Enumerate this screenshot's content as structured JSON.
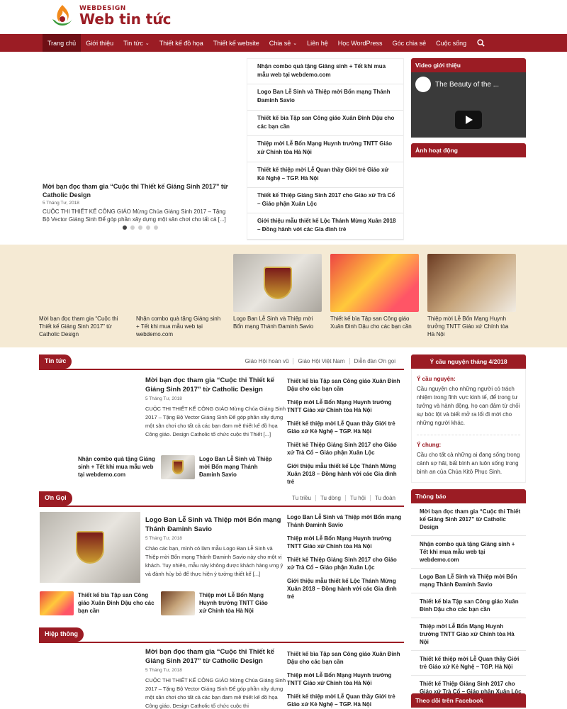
{
  "brand": {
    "sub": "WEBDESIGN",
    "main": "Web tin tức",
    "accent": "#9b1c24"
  },
  "nav": {
    "items": [
      {
        "label": "Trang chủ",
        "active": true
      },
      {
        "label": "Giới thiệu"
      },
      {
        "label": "Tin tức",
        "caret": true
      },
      {
        "label": "Thiết kế đồ họa"
      },
      {
        "label": "Thiết kế website"
      },
      {
        "label": "Chia sẻ",
        "caret": true
      },
      {
        "label": "Liên hệ"
      },
      {
        "label": "Học WordPress"
      },
      {
        "label": "Góc chia sẻ"
      },
      {
        "label": "Cuộc sống"
      }
    ],
    "search_icon": "search-icon"
  },
  "hero": {
    "title": "Mời bạn đọc tham gia “Cuộc thi Thiết kế Giáng Sinh 2017” từ Catholic Design",
    "date": "5 Tháng Tư, 2018",
    "excerpt": "CUỘC THI THIẾT KẾ CÔNG GIÁO Mừng Chúa Giáng Sinh 2017 – Tặng Bộ Vector Giáng Sinh Để góp phần xây dựng một sân chơi cho tất cả [...]",
    "slide_count": 5,
    "active_slide": 1,
    "list": [
      "Nhận combo quà tặng Giáng sinh + Tết khi mua mẫu web tại webdemo.com",
      "Logo Ban Lễ Sinh và Thiệp mời Bổn mạng Thánh Đaminh Savio",
      "Thiết kế bìa Tập san Công giáo Xuân Đinh Dậu cho các bạn cần",
      "Thiệp mời Lễ Bổn Mạng Huynh trưởng TNTT Giáo xứ Chính tòa Hà Nội",
      "Thiết kế thiệp mời Lễ Quan thầy Giới trẻ Giáo xứ Kẻ Nghệ – TGP. Hà Nội",
      "Thiết kế Thiệp Giáng Sinh 2017 cho Giáo xứ Trà Cổ – Giáo phận Xuân Lộc",
      "Giới thiệu mẫu thiết kế Lộc Thánh Mừng Xuân 2018 – Đồng hành với các Gia đình trẻ"
    ]
  },
  "sidebar": {
    "video_title": "Video giới thiệu",
    "video_caption": "The Beauty of the ...",
    "photos_title": "Ảnh hoạt động",
    "prayer_title": "Ý cầu nguyện tháng 4/2018",
    "prayer": [
      {
        "label": "Ý cầu nguyện:",
        "text": "Cầu nguyện cho những người có trách nhiệm trong lĩnh vực kinh tế, để trong tư tưởng và hành động, họ can đảm từ chối sự bóc lột và biết mở ra lối đi mới cho những người khác."
      },
      {
        "label": "Ý chung:",
        "text": "Cầu cho tất cả những ai đang sống trong cảnh sợ hãi, bất bình an luôn sống trong bình an của Chúa Kitô Phục Sinh."
      }
    ],
    "notice_title": "Thông báo",
    "notices": [
      "Mời bạn đọc tham gia “Cuộc thi Thiết kế Giáng Sinh 2017” từ Catholic Design",
      "Nhận combo quà tặng Giáng sinh + Tết khi mua mẫu web tại webdemo.com",
      "Logo Ban Lễ Sinh và Thiệp mời Bổn mạng Thánh Đaminh Savio",
      "Thiết kế bìa Tập san Công giáo Xuân Đinh Dậu cho các bạn cần",
      "Thiệp mời Lễ Bổn Mạng Huynh trưởng TNTT Giáo xứ Chính tòa Hà Nội",
      "Thiết kế thiệp mời Lễ Quan thầy Giới trẻ Giáo xứ Kẻ Nghệ – TGP. Hà Nội",
      "Thiết kế Thiệp Giáng Sinh 2017 cho Giáo xứ Trà Cổ – Giáo phận Xuân Lộc"
    ],
    "facebook_title": "Theo dõi trên Facebook"
  },
  "band": [
    "Mời bạn đọc tham gia “Cuộc thi Thiết kế Giáng Sinh 2017” từ Catholic Design",
    "Nhận combo quà tặng Giáng sinh + Tết khi mua mẫu web tại webdemo.com",
    "Logo Ban Lễ Sinh và Thiệp mời Bổn mạng Thánh Đaminh Savio",
    "Thiết kế bìa Tập san Công giáo Xuân Đinh Dậu cho các bạn cần",
    "Thiệp mời Lễ Bổn Mạng Huynh trưởng TNTT Giáo xứ Chính tòa Hà Nội"
  ],
  "sections": {
    "news": {
      "tab": "Tin tức",
      "links": [
        "Giáo Hội hoàn vũ",
        "Giáo Hội Việt Nam",
        "Diễn đàn Ơn gọi"
      ],
      "main_title": "Mời bạn đọc tham gia “Cuộc thi Thiết kế Giáng Sinh 2017” từ Catholic Design",
      "main_date": "5 Tháng Tư, 2018",
      "main_excerpt": "CUỘC THI THIẾT KẾ CÔNG GIÁO Mừng Chúa Giáng Sinh 2017 – Tặng Bộ Vector Giáng Sinh Để góp phần xây dựng một sân chơi cho tất cả các bạn đam mê thiết kế đồ họa Công giáo. Design Catholic tổ chức cuộc thi Thiết [...]",
      "thumbs": [
        "Nhận combo quà tặng Giáng sinh + Tết khi mua mẫu web tại webdemo.com",
        "Logo Ban Lễ Sinh và Thiệp mời Bổn mạng Thánh Đaminh Savio"
      ],
      "list": [
        "Thiết kế bìa Tập san Công giáo Xuân Đinh Dậu cho các bạn cần",
        "Thiệp mời Lễ Bổn Mạng Huynh trưởng TNTT Giáo xứ Chính tòa Hà Nội",
        "Thiết kế thiệp mời Lễ Quan thầy Giới trẻ Giáo xứ Kẻ Nghệ – TGP. Hà Nội",
        "Thiết kế Thiệp Giáng Sinh 2017 cho Giáo xứ Trà Cổ – Giáo phận Xuân Lộc",
        "Giới thiệu mẫu thiết kế Lộc Thánh Mừng Xuân 2018 – Đồng hành với các Gia đình trẻ"
      ]
    },
    "vocation": {
      "tab": "Ơn Gọi",
      "links": [
        "Tu triều",
        "Tu dòng",
        "Tu hội",
        "Tu đoàn"
      ],
      "main_title": "Logo Ban Lễ Sinh và Thiệp mời Bổn mạng Thánh Đaminh Savio",
      "main_date": "5 Tháng Tư, 2018",
      "main_excerpt": "Chào các bạn, mình có làm mẫu Logo Ban Lễ Sinh và Thiệp mời Bổn mạng Thánh Đaminh Savio này cho một vị khách. Tuy nhiên, mẫu này không được khách hàng ưng ý và đành hủy bỏ để thực hiện ý tưởng thiết kế [...]",
      "thumbs": [
        "Thiết kế bìa Tập san Công giáo Xuân Đinh Dậu cho các bạn cần",
        "Thiệp mời Lễ Bổn Mạng Huynh trưởng TNTT Giáo xứ Chính tòa Hà Nội"
      ],
      "list": [
        "Logo Ban Lễ Sinh và Thiệp mời Bổn mạng Thánh Đaminh Savio",
        "Thiệp mời Lễ Bổn Mạng Huynh trưởng TNTT Giáo xứ Chính tòa Hà Nội",
        "Thiết kế Thiệp Giáng Sinh 2017 cho Giáo xứ Trà Cổ – Giáo phận Xuân Lộc",
        "Giới thiệu mẫu thiết kế Lộc Thánh Mừng Xuân 2018 – Đồng hành với các Gia đình trẻ"
      ]
    },
    "fellowship": {
      "tab": "Hiệp thông",
      "main_title": "Mời bạn đọc tham gia “Cuộc thi Thiết kế Giáng Sinh 2017” từ Catholic Design",
      "main_date": "5 Tháng Tư, 2018",
      "main_excerpt": "CUỘC THI THIẾT KẾ CÔNG GIÁO Mừng Chúa Giáng Sinh 2017 – Tặng Bộ Vector Giáng Sinh Để góp phần xây dựng một sân chơi cho tất cả các bạn đam mê thiết kế đồ họa Công giáo. Design Catholic tổ chức cuộc thi",
      "list": [
        "Thiết kế bìa Tập san Công giáo Xuân Đinh Dậu cho các bạn cần",
        "Thiệp mời Lễ Bổn Mạng Huynh trưởng TNTT Giáo xứ Chính tòa Hà Nội",
        "Thiết kế thiệp mời Lễ Quan thầy Giới trẻ Giáo xứ Kẻ Nghệ – TGP. Hà Nội"
      ]
    }
  }
}
